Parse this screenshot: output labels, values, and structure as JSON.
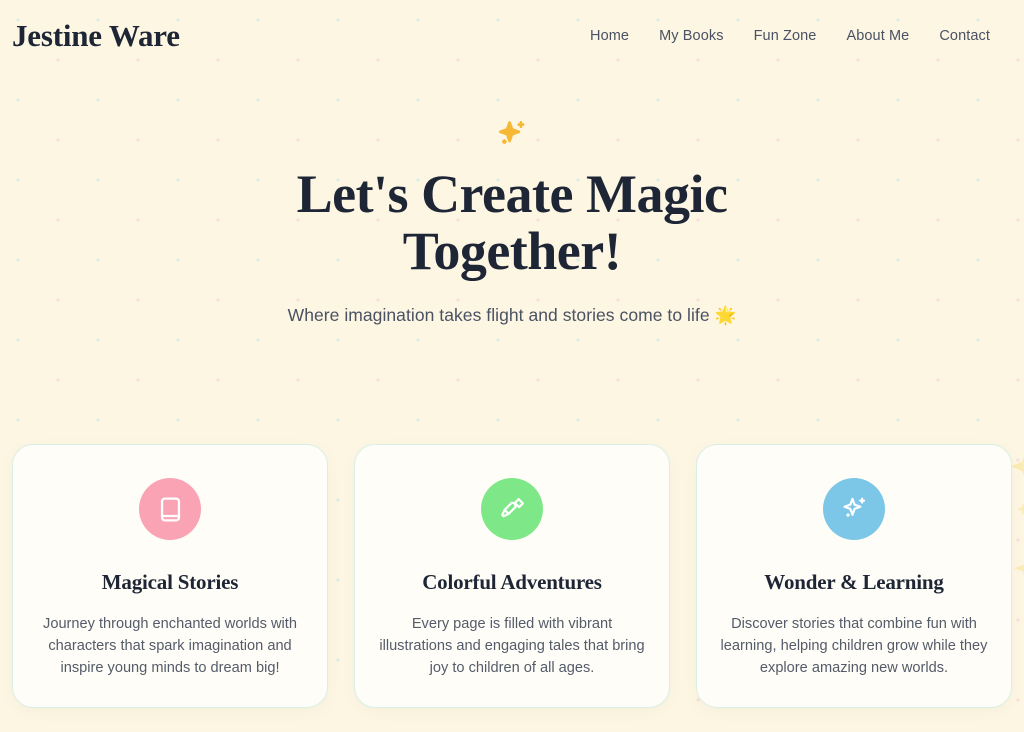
{
  "theme": {
    "background": "#fdf6e3",
    "text_dark": "#1e2636",
    "text_muted": "#4a5263",
    "card_background": "#fffdf7",
    "card_border": "#d8f0e6",
    "accent_gold": "#f5b935",
    "dot_pink": "#fadfdb",
    "dot_mint": "#ddeee6"
  },
  "header": {
    "brand": "Jestine Ware",
    "nav": [
      {
        "label": "Home",
        "name": "nav-home"
      },
      {
        "label": "My Books",
        "name": "nav-my-books"
      },
      {
        "label": "Fun Zone",
        "name": "nav-fun-zone"
      },
      {
        "label": "About Me",
        "name": "nav-about-me"
      },
      {
        "label": "Contact",
        "name": "nav-contact"
      }
    ]
  },
  "hero": {
    "sparkle_icon": "sparkles-icon",
    "title": "Let's Create Magic Together!",
    "title_line1": "Let's Create Magic",
    "title_line2": "Together!",
    "subtitle": "Where imagination takes flight and stories come to life 🌟"
  },
  "cards": [
    {
      "icon": "book-icon",
      "icon_color": "#f9a3b4",
      "title": "Magical Stories",
      "description": "Journey through enchanted worlds with characters that spark imagination and inspire young minds to dream big!"
    },
    {
      "icon": "paintbrush-icon",
      "icon_color": "#7ee889",
      "title": "Colorful Adventures",
      "description": "Every page is filled with vibrant illustrations and engaging tales that bring joy to children of all ages."
    },
    {
      "icon": "sparkles-icon",
      "icon_color": "#7cc7e8",
      "title": "Wonder & Learning",
      "description": "Discover stories that combine fun with learning, helping children grow while they explore amazing new worlds."
    }
  ]
}
